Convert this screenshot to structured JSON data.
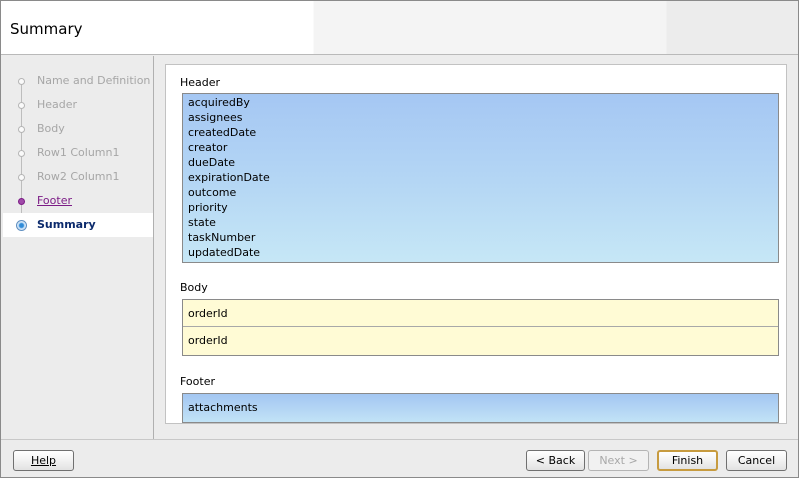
{
  "header": {
    "title": "Summary"
  },
  "steps": [
    {
      "label": "Name and Definition",
      "state": "inactive"
    },
    {
      "label": "Header",
      "state": "inactive"
    },
    {
      "label": "Body",
      "state": "inactive"
    },
    {
      "label": "Row1 Column1",
      "state": "inactive"
    },
    {
      "label": "Row2 Column1",
      "state": "inactive"
    },
    {
      "label": "Footer",
      "state": "visited"
    },
    {
      "label": "Summary",
      "state": "current"
    }
  ],
  "summary": {
    "header_label": "Header",
    "header_items": [
      "acquiredBy",
      "assignees",
      "createdDate",
      "creator",
      "dueDate",
      "expirationDate",
      "outcome",
      "priority",
      "state",
      "taskNumber",
      "updatedDate"
    ],
    "body_label": "Body",
    "body_items": [
      "orderId",
      "orderId"
    ],
    "footer_label": "Footer",
    "footer_items": [
      "attachments"
    ]
  },
  "buttons": {
    "help": "Help",
    "back": "< Back",
    "next": "Next >",
    "finish": "Finish",
    "cancel": "Cancel"
  },
  "colors": {
    "current_step": "#0b2a6c",
    "visited_step": "#7c1c86",
    "header_list_bg": "#b5d7f4",
    "body_list_bg": "#fffbd5",
    "default_button_border": "#c79b3f"
  }
}
